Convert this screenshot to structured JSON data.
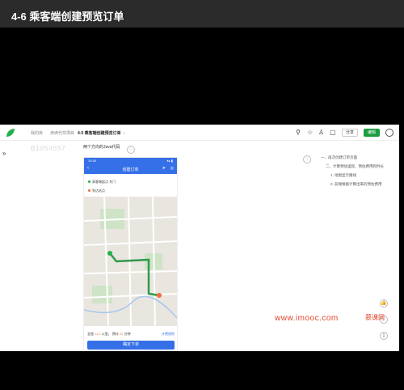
{
  "window": {
    "title": "4-6 乘客端创建预览订单"
  },
  "topbar": {
    "crumbs": [
      "我的库",
      "滴滴代驾项目",
      "4-5 乘客端创建预览订单"
    ],
    "crumb_separator": "⌄",
    "share_label": "分享",
    "edit_label": "编辑"
  },
  "watermark": {
    "text": "@1054557"
  },
  "doc": {
    "heading": "两个方向的Java代码"
  },
  "phone": {
    "status_time": "10:30",
    "status_right": "▾▴ ▮",
    "nav_title": "创建订单",
    "start_label": "乘客端起点·东门",
    "end_label": "到达站点",
    "price_prefix": "全程",
    "distance": "11.0",
    "distance_unit": "公里，",
    "time_prefix": "预计",
    "duration": "22",
    "duration_unit": "分钟",
    "rule_link": "计费规则",
    "confirm_label": "确定下单"
  },
  "outline": {
    "items": [
      {
        "level": 1,
        "text": "一、再次创建订单页面"
      },
      {
        "level": 2,
        "text": "二、计算预估里程、预估费用和时长"
      },
      {
        "level": 3,
        "text": "1. 地图显示路线"
      },
      {
        "level": 3,
        "text": "2. 前端根据计算出来的预估费用"
      }
    ]
  },
  "footer": {
    "site": "www.imooc.com",
    "brand": "慕课网"
  },
  "colors": {
    "accent": "#3670e8",
    "brand_green": "#1a9e3f",
    "imooc_red": "#e0452c"
  }
}
